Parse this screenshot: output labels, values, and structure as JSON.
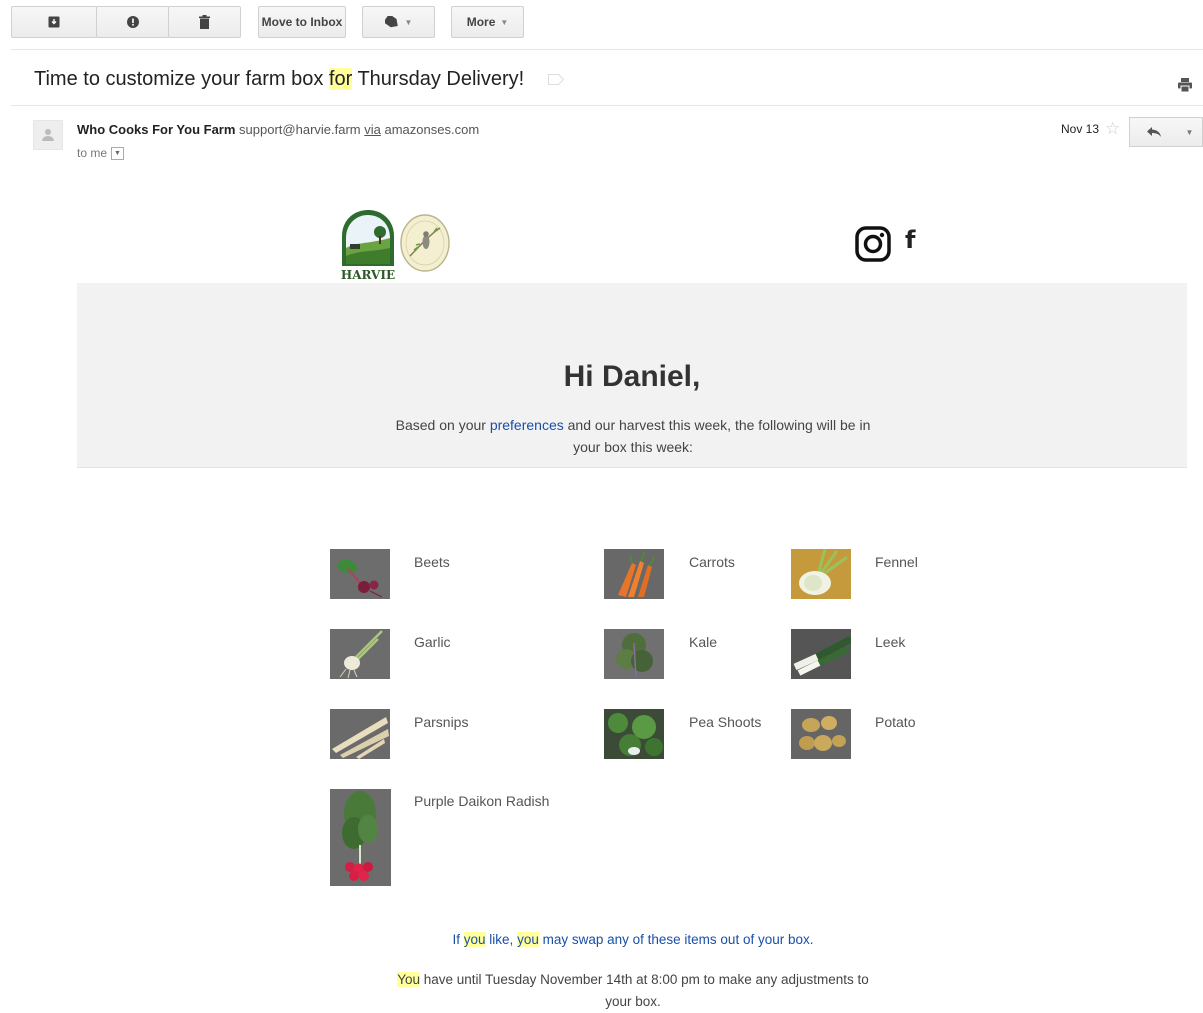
{
  "toolbar": {
    "move_to_inbox": "Move to Inbox",
    "more": "More"
  },
  "message": {
    "subject_before": "Time to customize your farm box ",
    "subject_highlight": "for",
    "subject_after": " Thursday Delivery!",
    "sender_name": "Who Cooks For You Farm",
    "sender_email": "support@harvie.farm",
    "via": "via",
    "via_domain": "amazonses.com",
    "to": "to me",
    "date": "Nov 13"
  },
  "email": {
    "logo_text": "HARVIE",
    "greeting": "Hi Daniel,",
    "intro_before": "Based on your ",
    "intro_link": "preferences",
    "intro_after": " and our harvest this week, the following will be in your box this week:",
    "items": [
      {
        "name": "Beets"
      },
      {
        "name": "Carrots"
      },
      {
        "name": "Fennel"
      },
      {
        "name": "Garlic"
      },
      {
        "name": "Kale"
      },
      {
        "name": "Leek"
      },
      {
        "name": "Parsnips"
      },
      {
        "name": "Pea Shoots"
      },
      {
        "name": "Potato"
      },
      {
        "name": "Purple Daikon Radish"
      }
    ],
    "swap_1": "If ",
    "swap_you_1": "you",
    "swap_2": " like, ",
    "swap_you_2": "you",
    "swap_3": " may swap any of these items out of your box.",
    "deadline_you": "You",
    "deadline_text": " have until Tuesday November 14th at 8:00 pm to make any adjustments to your box."
  },
  "colors": {
    "highlight": "#ffff9c",
    "link": "#1a4fa8",
    "hero_bg": "#f2f2f2"
  }
}
